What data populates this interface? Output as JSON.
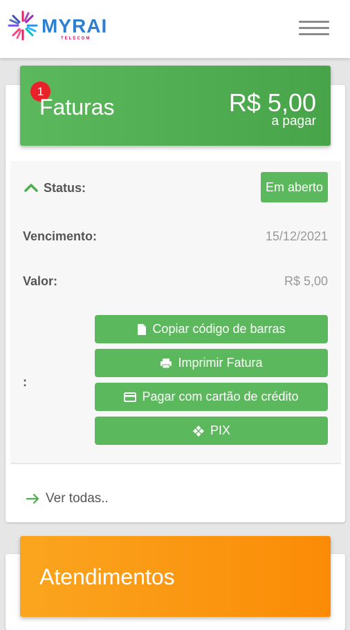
{
  "header": {
    "brand": "MYRAI",
    "brand_sub": "TELECOM",
    "menu_icon": "hamburger-menu-icon"
  },
  "faturas": {
    "title": "Faturas",
    "badge_count": "1",
    "amount": "R$ 5,00",
    "amount_label": "a pagar",
    "color": "#5cb85c"
  },
  "details": {
    "status_label": "Status:",
    "status_value": "Em aberto",
    "vencimento_label": "Vencimento:",
    "vencimento_value": "15/12/2021",
    "valor_label": "Valor:",
    "valor_value": "R$ 5,00",
    "actions_label": ":"
  },
  "actions": [
    {
      "label": "Copiar código de barras",
      "icon": "document-icon"
    },
    {
      "label": "Imprimir Fatura",
      "icon": "print-icon"
    },
    {
      "label": "Pagar com cartão de crédito",
      "icon": "credit-card-icon"
    },
    {
      "label": "PIX",
      "icon": "pix-icon"
    }
  ],
  "see_all": "Ver todas..",
  "atendimentos": {
    "title": "Atendimentos",
    "color": "#fb8b06"
  }
}
